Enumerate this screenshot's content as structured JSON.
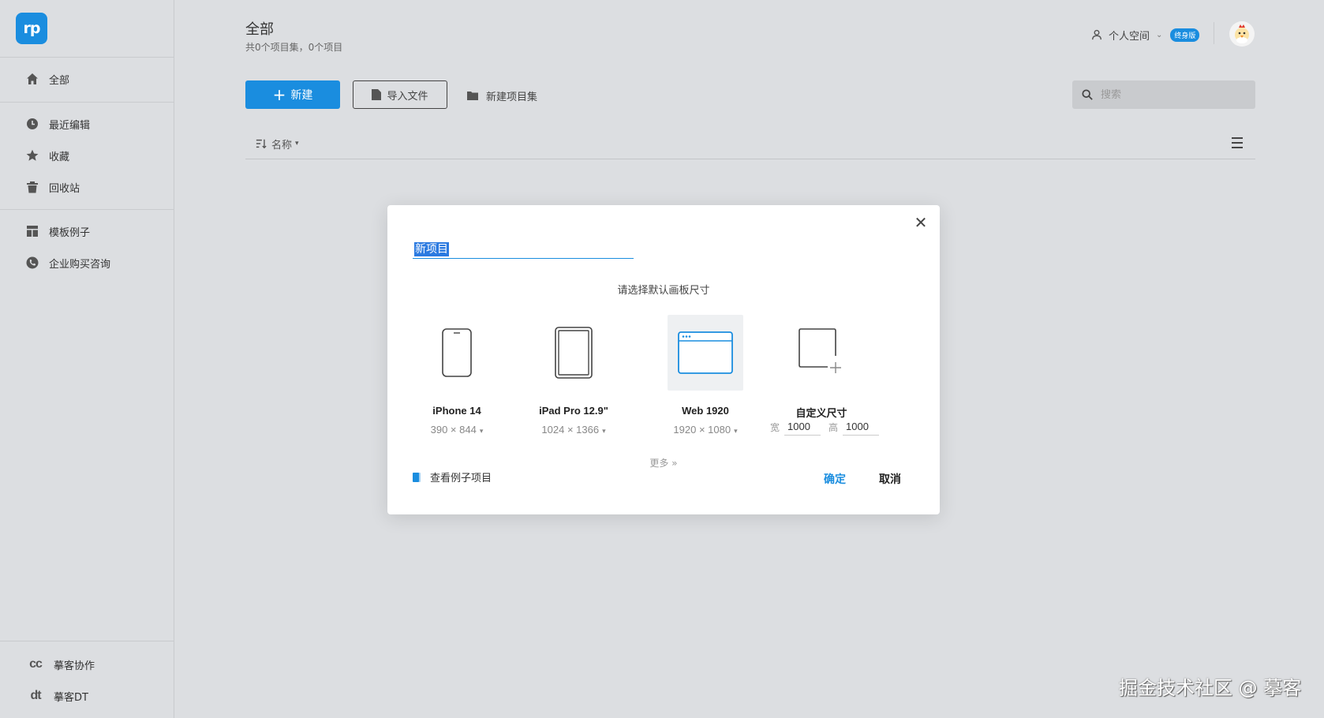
{
  "sidebar": {
    "logo": "rp",
    "items": [
      {
        "label": "全部",
        "icon": "home-icon"
      },
      {
        "label": "最近编辑",
        "icon": "clock-icon"
      },
      {
        "label": "收藏",
        "icon": "star-icon"
      },
      {
        "label": "回收站",
        "icon": "trash-icon"
      },
      {
        "label": "模板例子",
        "icon": "template-icon"
      },
      {
        "label": "企业购买咨询",
        "icon": "phone-icon"
      }
    ],
    "bottom": [
      {
        "label": "摹客协作",
        "icon": "cc"
      },
      {
        "label": "摹客DT",
        "icon": "dt"
      }
    ]
  },
  "header": {
    "title": "全部",
    "subtitle": "共0个项目集，0个项目",
    "space_label": "个人空间",
    "badge": "终身版"
  },
  "toolbar": {
    "new_label": "新建",
    "import_label": "导入文件",
    "new_set_label": "新建项目集",
    "search_placeholder": "搜索",
    "sort_label": "名称"
  },
  "dialog": {
    "project_name": "新项目",
    "prompt": "请选择默认画板尺寸",
    "options": [
      {
        "name": "iPhone 14",
        "dims": "390 × 844"
      },
      {
        "name": "iPad Pro 12.9\"",
        "dims": "1024 × 1366"
      },
      {
        "name": "Web 1920",
        "dims": "1920 × 1080"
      },
      {
        "name": "自定义尺寸"
      }
    ],
    "selected_option": "Web 1920",
    "custom": {
      "width_label": "宽",
      "width_value": "1000",
      "height_label": "高",
      "height_value": "1000"
    },
    "more_label": "更多",
    "examples_label": "查看例子项目",
    "ok_label": "确定",
    "cancel_label": "取消"
  },
  "watermark": "掘金技术社区 @ 摹客",
  "colors": {
    "accent": "#1a8ddf",
    "background": "#dcdee1",
    "modal": "#ffffff"
  }
}
